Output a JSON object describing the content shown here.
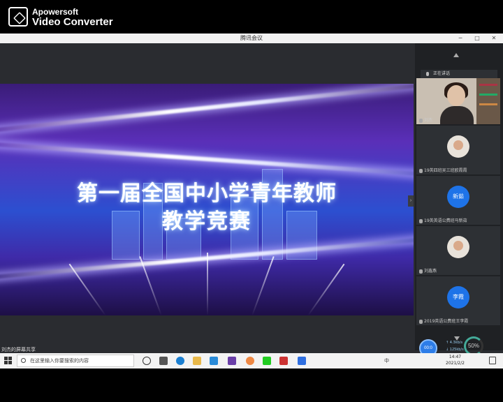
{
  "watermark": {
    "line1": "Apowersoft",
    "line2": "Video Converter"
  },
  "window": {
    "title": "腾讯会议",
    "minimize": "─",
    "maximize": "□",
    "close": "✕"
  },
  "slide": {
    "title_line1": "第一届全国中小学青年教师",
    "title_line2": "教学竞赛"
  },
  "panel": {
    "speaking_label": "正在讲话",
    "tiles": [
      {
        "label": "刘杰"
      },
      {
        "label": "19英四班吴三班欧霞霞"
      },
      {
        "label": "19英英语公费班马新茹",
        "avatar_text": "新茹"
      },
      {
        "label": "刘鑫燕"
      },
      {
        "label": "2019英语公费班王李霞",
        "avatar_text": "李霞"
      }
    ],
    "join_label": "00:0",
    "net_up": "↑ 4.3kb/s",
    "net_down": "↓ 125kb/s",
    "cpu": "50%"
  },
  "share_bar": "刘杰的屏幕共享",
  "taskbar": {
    "search_placeholder": "在这里输入你要搜索的内容",
    "ime": "中",
    "time": "14:47",
    "date": "2021/2/2"
  },
  "colors": {
    "accent_blue": "#1e73e8",
    "panel_bg": "#1f2124"
  }
}
